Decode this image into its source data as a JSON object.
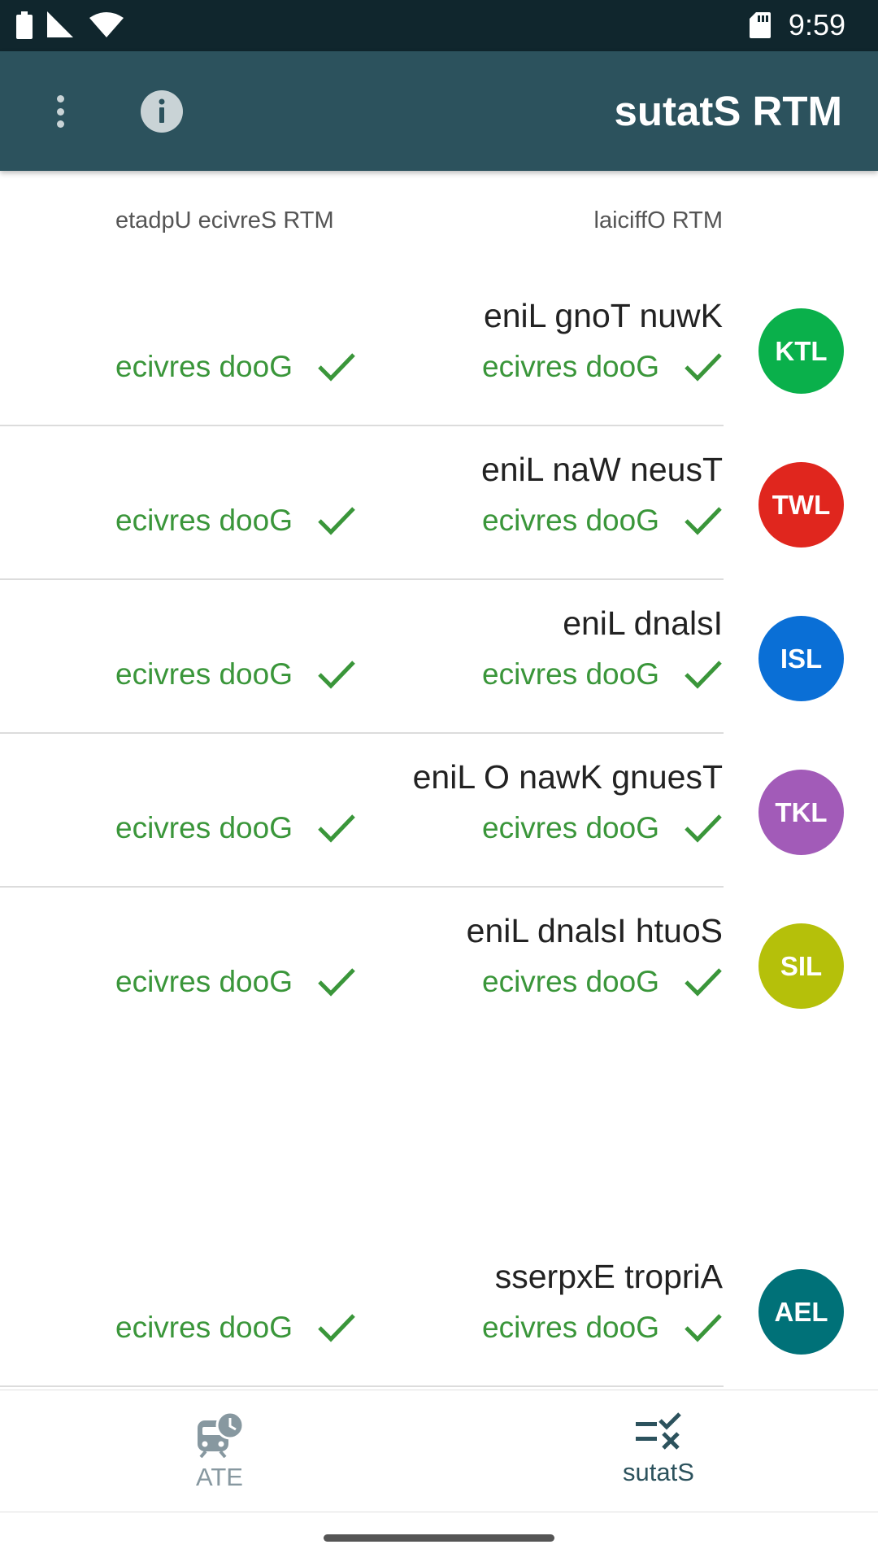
{
  "status_bar": {
    "time": "9:59"
  },
  "app_bar": {
    "title": "sutatS RTM"
  },
  "columns": {
    "official": "laiciffO RTM",
    "service_update": "etadpU ecivreS RTM"
  },
  "lines": [
    {
      "code": "KTL",
      "name": "eniL gnoT nuwK",
      "color": "#0ab04b",
      "official_status": "ecivres dooG",
      "service_status": "ecivres dooG"
    },
    {
      "code": "TWL",
      "name": "eniL naW neusT",
      "color": "#e0261e",
      "official_status": "ecivres dooG",
      "service_status": "ecivres dooG"
    },
    {
      "code": "ISL",
      "name": "eniL dnalsI",
      "color": "#0a6fd6",
      "official_status": "ecivres dooG",
      "service_status": "ecivres dooG"
    },
    {
      "code": "TKL",
      "name": "eniL O nawK gnuesT",
      "color": "#a25bb8",
      "official_status": "ecivres dooG",
      "service_status": "ecivres dooG"
    },
    {
      "code": "SIL",
      "name": "eniL dnalsI htuoS",
      "color": "#b5c00a",
      "official_status": "ecivres dooG",
      "service_status": "ecivres dooG"
    },
    {
      "code": "AEL",
      "name": "sserpxE tropriA",
      "color": "#007178",
      "official_status": "ecivres dooG",
      "service_status": "ecivres dooG"
    }
  ],
  "bottom_nav": {
    "eta_label": "ATE",
    "status_label": "sutatS"
  },
  "colors": {
    "good_service": "#3a963a",
    "app_bar": "#2c525d",
    "status_bar": "#10262d"
  }
}
